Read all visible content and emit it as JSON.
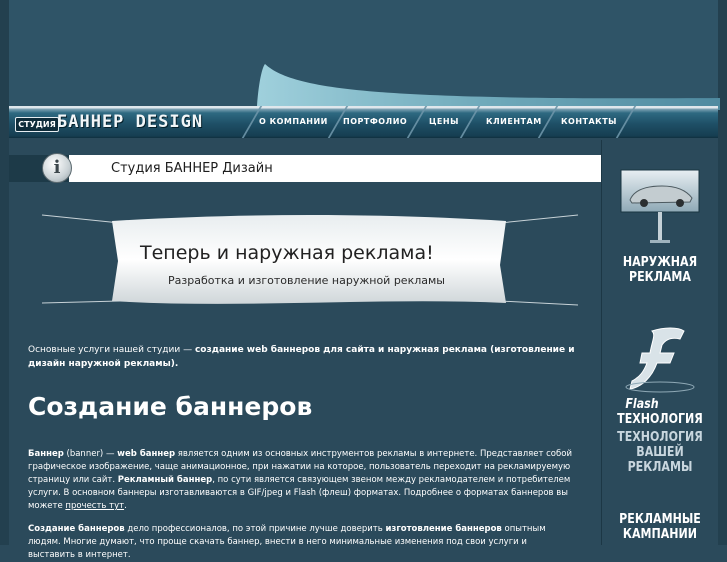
{
  "brand": {
    "label": "СТУДИЯ",
    "name": "БАННЕР DESIGN"
  },
  "nav": {
    "items": [
      {
        "label": "О КОМПАНИИ"
      },
      {
        "label": "ПОРТФОЛИО"
      },
      {
        "label": "ЦЕНЫ"
      },
      {
        "label": "КЛИЕНТАМ"
      },
      {
        "label": "КОНТАКТЫ"
      }
    ]
  },
  "page": {
    "title": "Студия БАННЕР Дизайн"
  },
  "banner": {
    "headline": "Теперь и наружная реклама!",
    "subline": "Разработка и изготовление наружной рекламы"
  },
  "intro": {
    "text_start": "Основные услуги нашей студии — ",
    "text_bold": "создание web баннеров для сайта и наружная реклама (изготовление и дизайн наружной рекламы)."
  },
  "section": {
    "heading": "Создание баннеров"
  },
  "para1": {
    "b1": "Баннер",
    "t1": " (banner) — ",
    "b2": "web баннер",
    "t2": " является одним из основных инструментов рекламы в интернете. Представляет собой графическое изображение, чаще анимационное, при нажатии на которое, пользователь переходит на рекламируемую страницу или сайт. ",
    "b3": "Рекламный баннер",
    "t3": ", по сути является связующем звеном между рекламодателем и потребителем услуги. В основном баннеры изготавливаются в GIF/jpeg и Flash (флеш) форматах. Подробнее о форматах баннеров вы можете ",
    "link": "прочесть тут",
    "t4": "."
  },
  "para2": {
    "b1": "Создание баннеров",
    "t1": " дело профессионалов, по этой причине лучше доверить ",
    "b2": "изготовление баннеров",
    "t2": " опытным людям. Многие думают, что проще скачать баннер, внести в него минимальные изменения под свои услуги и выставить в интернет."
  },
  "sidebar": {
    "promo1": "НАРУЖНАЯ РЕКЛАМА",
    "promo2_flash": "Flash",
    "promo2_line1": "ТЕХНОЛОГИЯ",
    "promo2_line2": "ТЕХНОЛОГИЯ ВАШЕЙ РЕКЛАМЫ",
    "promo3": "РЕКЛАМНЫЕ КАМПАНИИ"
  },
  "colors": {
    "background": "#2b4a5b",
    "nav": "#1e4f66",
    "accent_swoosh": "#8fc3d0",
    "text": "#ffffff"
  }
}
